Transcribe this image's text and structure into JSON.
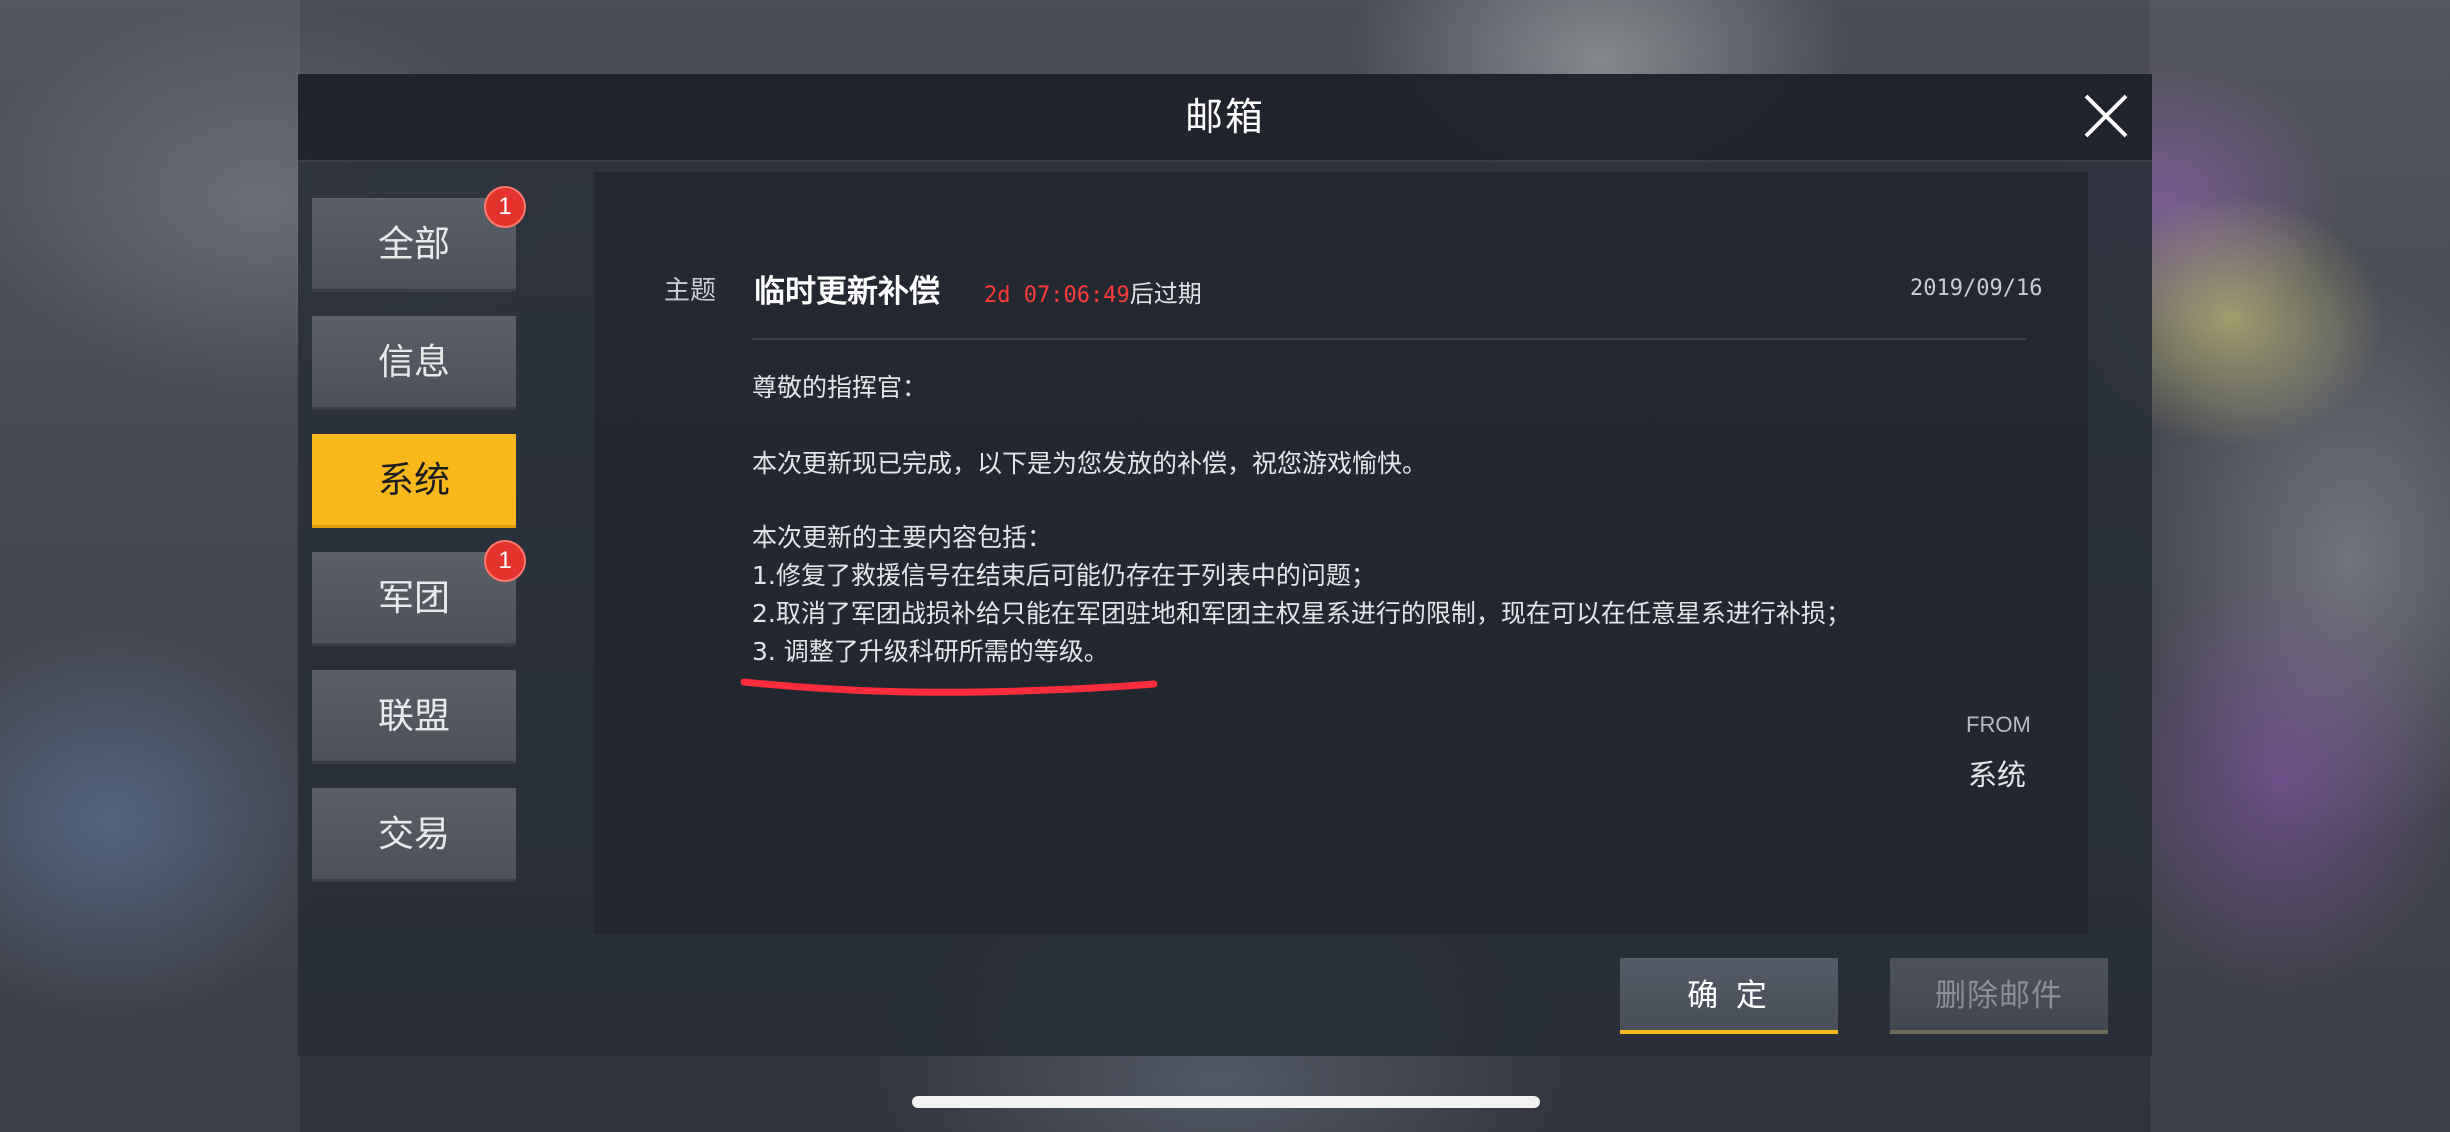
{
  "dialog": {
    "title": "邮箱"
  },
  "sidebar": {
    "tabs": [
      {
        "id": "all",
        "label": "全部",
        "badge": "1",
        "active": false
      },
      {
        "id": "info",
        "label": "信息",
        "badge": null,
        "active": false
      },
      {
        "id": "system",
        "label": "系统",
        "badge": null,
        "active": true
      },
      {
        "id": "legion",
        "label": "军团",
        "badge": "1",
        "active": false
      },
      {
        "id": "alliance",
        "label": "联盟",
        "badge": null,
        "active": false
      },
      {
        "id": "trade",
        "label": "交易",
        "badge": null,
        "active": false
      }
    ]
  },
  "mail": {
    "subject_label": "主题",
    "subject": "临时更新补偿",
    "countdown": "2d 07:06:49",
    "expiry_suffix": "后过期",
    "date": "2019/09/16",
    "body": [
      "尊敬的指挥官：",
      "本次更新现已完成，以下是为您发放的补偿，祝您游戏愉快。",
      "本次更新的主要内容包括：",
      "1.修复了救援信号在结束后可能仍存在于列表中的问题；",
      "2.取消了军团战损补给只能在军团驻地和军团主权星系进行的限制，现在可以在任意星系进行补损；",
      "3. 调整了升级科研所需的等级。"
    ],
    "from_label": "FROM",
    "from_value": "系统"
  },
  "actions": {
    "confirm_label": "确 定",
    "delete_label": "删除邮件"
  },
  "colors": {
    "accent": "#f8b81b",
    "badge": "#e3332c",
    "countdown": "#ff3b3b",
    "annotation": "#ff2d3c"
  },
  "icons": {
    "close": "close-icon"
  }
}
